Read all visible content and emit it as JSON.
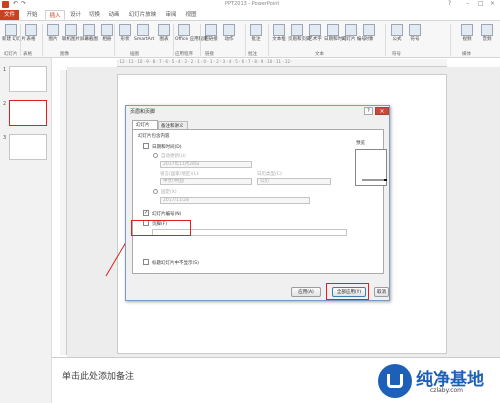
{
  "window": {
    "title": "PPT2013 - PowerPoint"
  },
  "tabs": [
    "文件",
    "开始",
    "插入",
    "设计",
    "切换",
    "动画",
    "幻灯片放映",
    "审阅",
    "视图"
  ],
  "active_tab_index": 2,
  "ribbon": {
    "buttons": [
      "新建\n幻灯片",
      "表格",
      "图片",
      "联机图片",
      "屏幕截图",
      "相册",
      "形状",
      "SmartArt",
      "图表",
      "Office\n应用程序",
      "超链接",
      "动作",
      "批注",
      "文本框",
      "页眉和页脚",
      "艺术字",
      "日期和时间",
      "幻灯片\n编号",
      "对象",
      "公式",
      "符号",
      "视频",
      "音频"
    ],
    "groups": [
      "幻灯片",
      "表格",
      "图像",
      "插图",
      "应用程序",
      "链接",
      "批注",
      "文本",
      "符号",
      "媒体"
    ]
  },
  "thumbnails": [
    {
      "num": "1"
    },
    {
      "num": "2"
    },
    {
      "num": "3"
    }
  ],
  "ruler_text": "· 12 · 11 · 10 · 9 · 8 · 7 · 6 · 5 · 4 · 3 · 2 · 1 · 0 · 1 · 2 · 3 · 4 · 5 · 6 · 7 · 8 · 9 · 10 · 11 · 12 ·",
  "notes_placeholder": "单击此处添加备注",
  "dialog": {
    "title": "页眉和页脚",
    "tab_slide": "幻灯片",
    "tab_notes": "备注和讲义",
    "include_label": "幻灯片包含内容",
    "date_time": "日期和时间(D)",
    "auto_update": "自动更新(U)",
    "date_value": "2017年11月28日",
    "language_label": "语言(国家/地区)(L):",
    "calendar_label": "日历类型(C):",
    "language_value": "中文(中国)",
    "calendar_value": "公历",
    "fixed": "固定(X)",
    "fixed_value": "2017/11/28",
    "slide_number": "幻灯片编号(N)",
    "footer": "页脚(F)",
    "hide_title": "标题幻灯片中不显示(S)",
    "preview": "预览",
    "apply": "应用(A)",
    "apply_all": "全部应用(Y)",
    "cancel": "取消",
    "help": "?",
    "close": "×"
  },
  "watermark": {
    "text": "纯净基地",
    "url": "czlaby.com"
  },
  "colors": {
    "file_tab": "#c9431f",
    "accent": "#c9431f",
    "highlight": "#e02020"
  }
}
